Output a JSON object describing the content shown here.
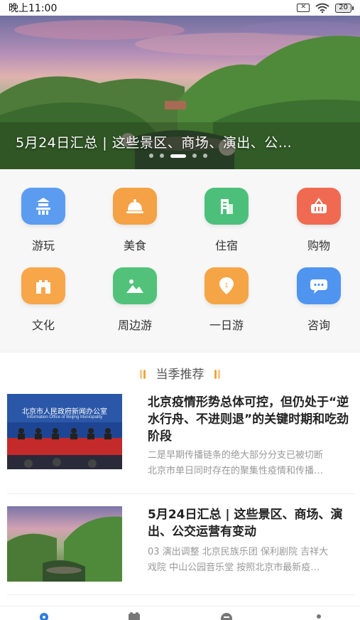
{
  "status_bar": {
    "time": "晚上11:00",
    "battery": "20"
  },
  "banner": {
    "caption": "5月24日汇总 | 这些景区、商场、演出、公…",
    "page_count": 5,
    "active_page": 3
  },
  "categories": [
    {
      "label": "游玩",
      "icon": "temple-icon",
      "color": "#5b9cf0"
    },
    {
      "label": "美食",
      "icon": "food-cloche-icon",
      "color": "#f4a245"
    },
    {
      "label": "住宿",
      "icon": "building-icon",
      "color": "#4cc07a"
    },
    {
      "label": "购物",
      "icon": "shopping-basket-icon",
      "color": "#f06a52"
    },
    {
      "label": "文化",
      "icon": "castle-icon",
      "color": "#f7a64a"
    },
    {
      "label": "周边游",
      "icon": "landscape-icon",
      "color": "#52c27a"
    },
    {
      "label": "一日游",
      "icon": "location-pin-icon",
      "color": "#f5a545"
    },
    {
      "label": "咨询",
      "icon": "chat-bubble-icon",
      "color": "#4f95f0"
    }
  ],
  "section": {
    "title": "当季推荐"
  },
  "articles": [
    {
      "title": "北京疫情形势总体可控，但仍处于“逆水行舟、不进则退”的关键时期和吃劲阶段",
      "desc_line1": "二是早期传播链条的绝大部分分支已被切断",
      "desc_line2": "北京市单日同时存在的聚集性疫情和传播…",
      "thumb_banner_cn": "北京市人民政府新闻办公室",
      "thumb_banner_en": "Information Office of Beijing Municipality"
    },
    {
      "title": "5月24日汇总 | 这些景区、商场、演出、公交运营有变动",
      "desc_line1": "03 演出调整 北京民族乐团 保利剧院 吉祥大",
      "desc_line2": "戏院 中山公园音乐堂 按照北京市最新疫…"
    }
  ],
  "tabbar": {
    "icons": [
      "location-icon",
      "map-icon",
      "ticket-icon",
      "user-icon"
    ]
  }
}
